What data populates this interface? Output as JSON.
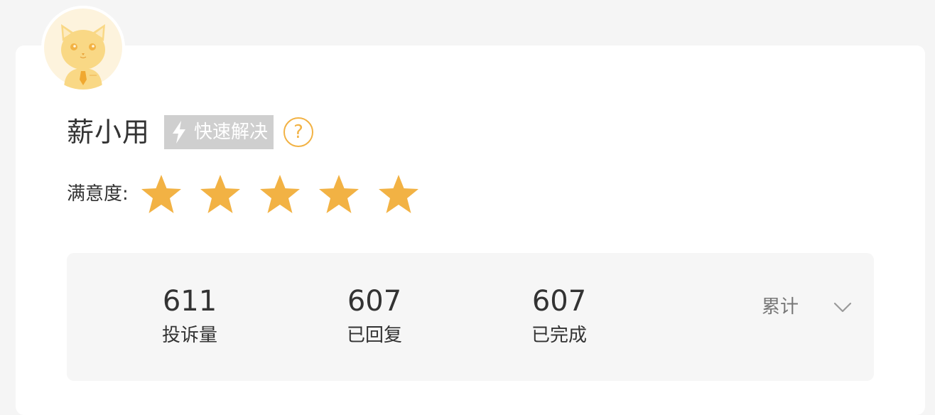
{
  "profile": {
    "name": "薪小用",
    "badge_label": "快速解决",
    "badge_icon": "lightning-bolt-icon",
    "help_icon_glyph": "?",
    "avatar_icon": "cat-mascot-avatar"
  },
  "rating": {
    "label": "满意度:",
    "value": 5,
    "max": 5,
    "star_color": "#f2b244"
  },
  "stats": [
    {
      "value": "611",
      "label": "投诉量"
    },
    {
      "value": "607",
      "label": "已回复"
    },
    {
      "value": "607",
      "label": "已完成"
    }
  ],
  "period_selector": {
    "selected": "累计",
    "icon": "chevron-down-icon"
  },
  "colors": {
    "accent": "#f2b244",
    "badge_background": "#cfcfcf",
    "panel_background": "#f6f6f6",
    "page_background": "#f5f5f5"
  }
}
